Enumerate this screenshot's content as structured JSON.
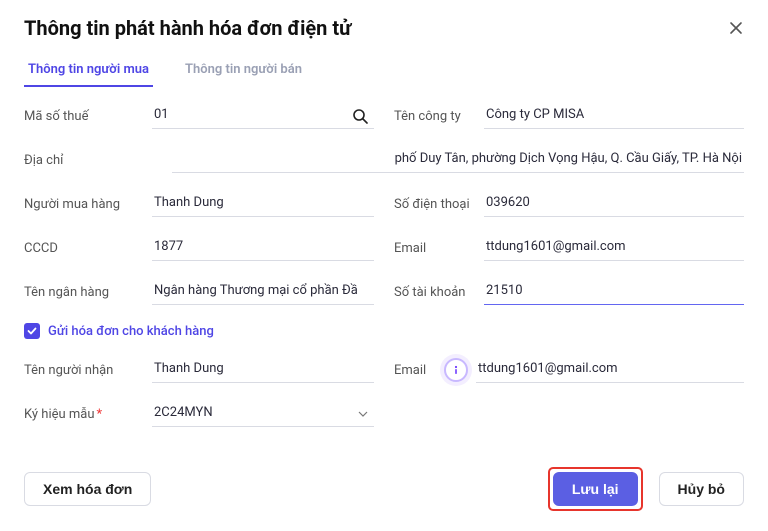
{
  "title": "Thông tin phát hành hóa đơn điện tử",
  "tabs": {
    "buyer": "Thông tin người mua",
    "seller": "Thông tin người bán"
  },
  "labels": {
    "tax_code": "Mã số thuế",
    "company": "Tên công ty",
    "address": "Địa chỉ",
    "buyer_name": "Người mua hàng",
    "phone": "Số điện thoại",
    "citizen_id": "CCCD",
    "email": "Email",
    "bank_name": "Tên ngân hàng",
    "account_no": "Số tài khoản",
    "send_invoice": "Gửi hóa đơn cho khách hàng",
    "recipient": "Tên người nhận",
    "recipient_email": "Email",
    "form_code": "Ký hiệu mẫu"
  },
  "values": {
    "tax_code": "01",
    "company": "Công ty CP MISA",
    "address": "phố Duy Tân, phường Dịch Vọng Hậu, Q. Cầu Giấy, TP. Hà Nội",
    "buyer_name": "Thanh Dung",
    "phone": "039620",
    "citizen_id": "1877",
    "email": "ttdung1601@gmail.com",
    "bank_name": "Ngân hàng Thương mại cổ phần Đầ",
    "account_no": "21510",
    "send_invoice_checked": true,
    "recipient": "Thanh Dung",
    "recipient_email": "ttdung1601@gmail.com",
    "form_code": "2C24MYN"
  },
  "buttons": {
    "view_invoice": "Xem hóa đơn",
    "save": "Lưu lại",
    "cancel": "Hủy bỏ"
  },
  "icons": {
    "close": "close-icon",
    "search": "search-icon",
    "chevron_down": "chevron-down-icon",
    "info": "info-icon",
    "check": "check-icon"
  }
}
